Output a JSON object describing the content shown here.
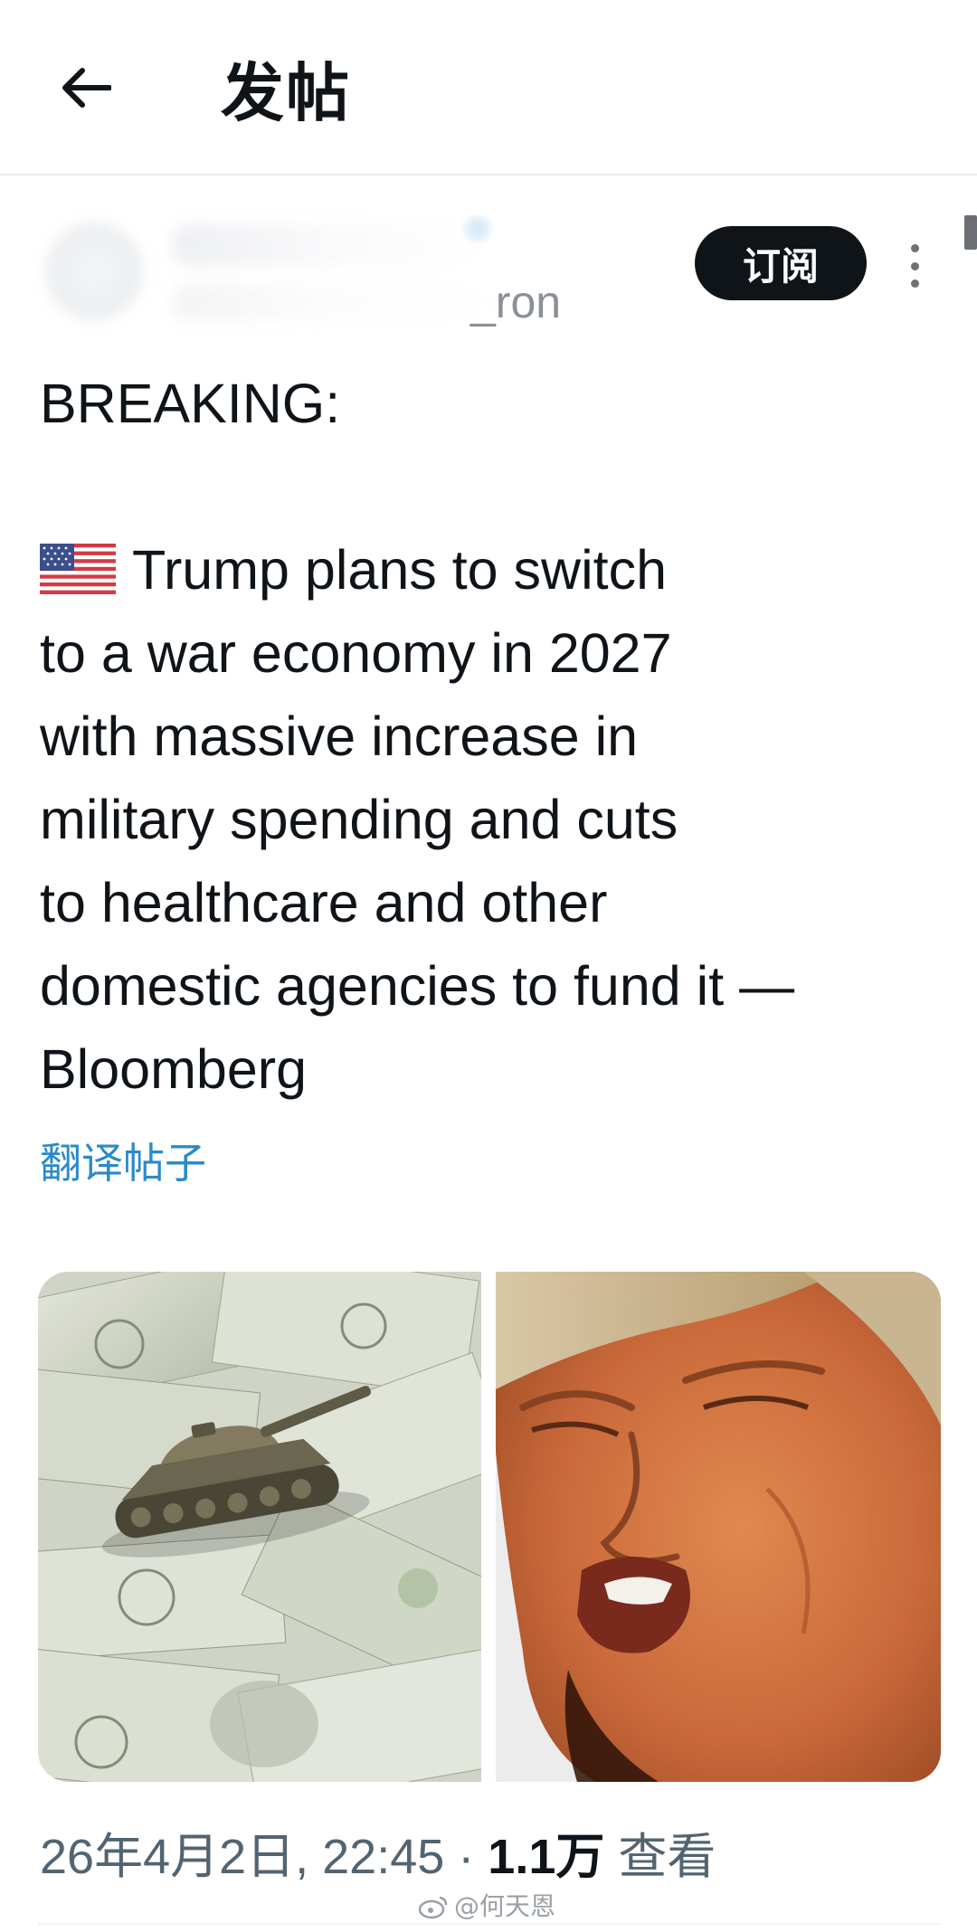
{
  "header": {
    "back_icon": "arrow-left-icon",
    "title": "发帖"
  },
  "author": {
    "handle_suffix": "_ron",
    "subscribe_label": "订阅",
    "more_icon": "more-vertical-icon"
  },
  "tweet": {
    "heading": "BREAKING:",
    "flag_icon": "us-flag-icon",
    "lines": [
      "Trump plans to switch",
      "to a war economy in 2027",
      "with massive increase in",
      "military spending and cuts",
      "to healthcare and other",
      "domestic agencies to fund it —",
      "Bloomberg"
    ],
    "translate_label": "翻译帖子"
  },
  "media": {
    "left_alt": "toy tank on dollar bills",
    "right_alt": "portrait photo"
  },
  "meta": {
    "datetime": "26年4月2日, 22:45",
    "separator": " · ",
    "views_count": "1.1万",
    "views_label": " 查看"
  },
  "watermark": {
    "text": "@何天恩"
  },
  "colors": {
    "link": "#2a8ac9",
    "text": "#0f1419",
    "secondary": "#536471",
    "button_bg": "#0f1419"
  }
}
